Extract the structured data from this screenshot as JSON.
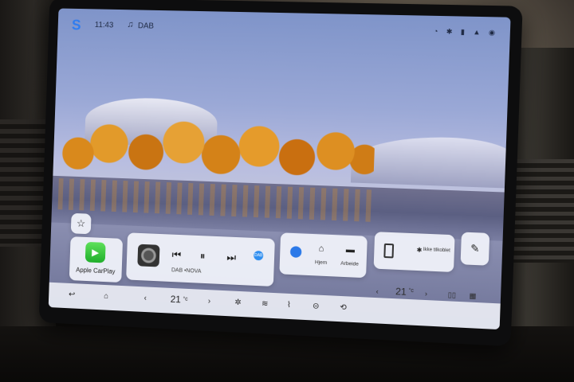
{
  "status_bar": {
    "time": "11:43",
    "source": "DAB"
  },
  "widgets": {
    "carplay_label": "Apple CarPlay",
    "station": "DAB •NOVA",
    "dab_badge": "DAB",
    "nav_home": "Hjem",
    "nav_work": "Arbeide",
    "phone_status": "Ikke tilkoblet"
  },
  "climate": {
    "right_temp": "21",
    "right_unit": "°c"
  },
  "dock": {
    "left_temp": "21",
    "left_unit": "°c"
  },
  "icons": [
    "back-icon",
    "home-icon",
    "chevron-left-icon",
    "chevron-right-icon",
    "fan-icon",
    "seat-heat-icon",
    "defrost-icon",
    "recirculation-icon",
    "split-screen-icon",
    "app-grid-icon",
    "play-icon",
    "pause-icon",
    "skip-prev-icon",
    "skip-next-icon",
    "map-pin-icon",
    "briefcase-icon",
    "bluetooth-icon",
    "edit-icon",
    "star-icon"
  ],
  "colors": {
    "carplay_green": "#1fae2b",
    "accent_blue": "#2f7df0"
  }
}
